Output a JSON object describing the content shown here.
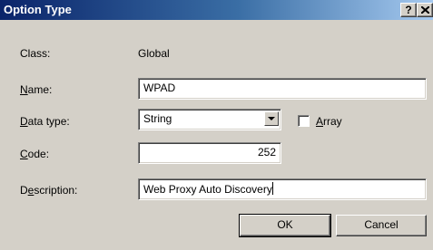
{
  "window": {
    "title": "Option Type",
    "help_glyph": "?",
    "close_icon": "close-icon"
  },
  "form": {
    "class": {
      "label": "Class:",
      "value": "Global"
    },
    "name": {
      "label_accel": "N",
      "label_rest": "ame:",
      "value": "WPAD"
    },
    "data_type": {
      "label_accel": "D",
      "label_rest": "ata type:",
      "selected": "String"
    },
    "array": {
      "label_accel": "A",
      "label_rest": "rray",
      "checked": false
    },
    "code": {
      "label_accel": "C",
      "label_rest": "ode:",
      "value": "252"
    },
    "description": {
      "label_pre": "D",
      "label_accel": "e",
      "label_rest": "scription:",
      "value": "Web Proxy Auto Discovery"
    }
  },
  "buttons": {
    "ok": "OK",
    "cancel": "Cancel"
  },
  "colors": {
    "title_start": "#0a246a",
    "title_end": "#a6caf0",
    "face": "#d4d0c8"
  }
}
